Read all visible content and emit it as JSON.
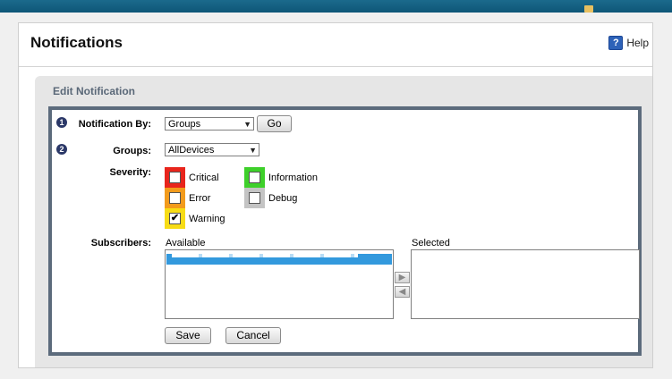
{
  "page": {
    "title": "Notifications",
    "help_label": "Help"
  },
  "section": {
    "title": "Edit Notification"
  },
  "form": {
    "notification_by": {
      "label": "Notification By:",
      "value": "Groups",
      "go_label": "Go"
    },
    "groups": {
      "label": "Groups:",
      "value": "AllDevices"
    },
    "severity": {
      "label": "Severity:",
      "items": [
        {
          "label": "Critical",
          "checked": false,
          "color": "#e8251c"
        },
        {
          "label": "Information",
          "checked": false,
          "color": "#3ed02a"
        },
        {
          "label": "Error",
          "checked": false,
          "color": "#f29b1c"
        },
        {
          "label": "Debug",
          "checked": false,
          "color": "#c4c4c4"
        },
        {
          "label": "Warning",
          "checked": true,
          "color": "#f7dc16"
        }
      ]
    },
    "subscribers": {
      "label": "Subscribers:",
      "available_label": "Available",
      "selected_label": "Selected"
    },
    "save_label": "Save",
    "cancel_label": "Cancel"
  },
  "steps": [
    "1",
    "2"
  ],
  "icons": {
    "help": "help-icon",
    "move_right": "arrow-right-icon",
    "move_left": "arrow-left-icon"
  },
  "glyphs": {
    "help": "?",
    "right": "▶",
    "left": "◀",
    "check": "✔",
    "dropdown": "▼"
  }
}
